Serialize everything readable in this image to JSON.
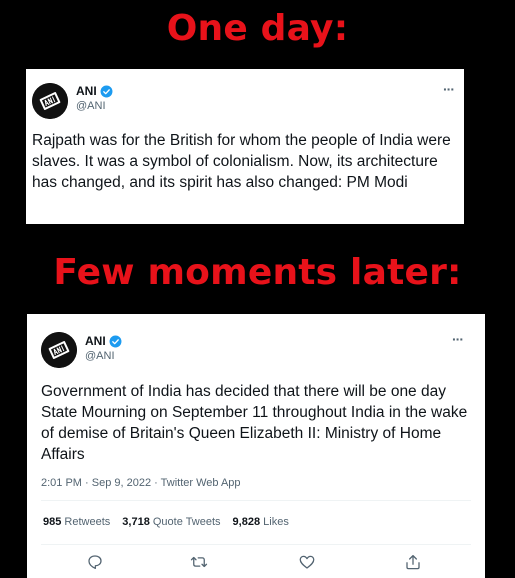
{
  "headline_top": "One day:",
  "headline_bottom": "Few moments later:",
  "tweet1": {
    "author_name": "ANI",
    "author_handle": "@ANI",
    "more": "···",
    "text": "Rajpath was for the British for whom the people of India were slaves. It was a symbol of colonialism. Now, its architecture has changed, and its spirit has also changed: PM Modi"
  },
  "tweet2": {
    "author_name": "ANI",
    "author_handle": "@ANI",
    "more": "···",
    "text": "Government of India has decided that there will be one day State Mourning on September 11 throughout India in the wake of demise of Britain's Queen Elizabeth II: Ministry of Home Affairs",
    "meta": "2:01 PM · Sep 9, 2022 · Twitter Web App",
    "retweets_count": "985",
    "retweets_label": "Retweets",
    "quotes_count": "3,718",
    "quotes_label": "Quote Tweets",
    "likes_count": "9,828",
    "likes_label": "Likes"
  },
  "colors": {
    "headline": "#e8121a",
    "verified": "#1d9bf0",
    "secondary_text": "#536471"
  },
  "icons": [
    "verified-badge-icon",
    "more-options-icon",
    "reply-icon",
    "retweet-icon",
    "like-icon",
    "share-icon"
  ]
}
